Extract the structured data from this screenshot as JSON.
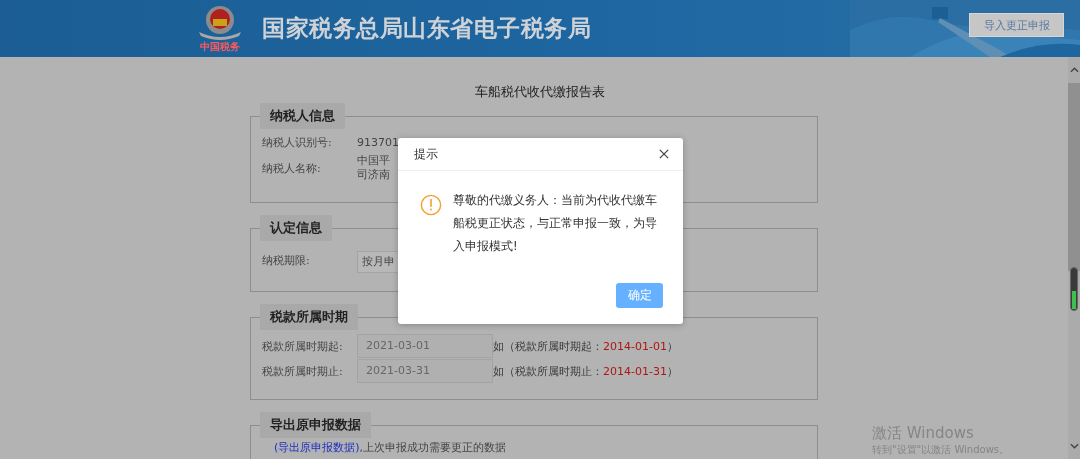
{
  "header": {
    "logo_caption": "中国税务",
    "title": "国家税务总局山东省电子税务局",
    "import_button": "导入更正申报"
  },
  "page_title": "车船税代收代缴报告表",
  "sections": [
    {
      "title": "纳税人信息",
      "kind": "info",
      "rows": [
        {
          "label": "纳税人识别号:",
          "values": [
            "913701"
          ]
        },
        {
          "label": "纳税人名称:",
          "values": [
            "中国平",
            "司济南"
          ]
        }
      ]
    },
    {
      "title": "认定信息",
      "kind": "select",
      "rows": [
        {
          "label": "纳税期限:",
          "value": "按月申"
        }
      ]
    },
    {
      "title": "税款所属时期",
      "kind": "dates",
      "rows": [
        {
          "label": "税款所属时期起:",
          "value": "2021-03-01",
          "note": {
            "prefix": "如（税款所属时期起：",
            "example": "2014-01-01",
            "suffix": "）"
          }
        },
        {
          "label": "税款所属时期止:",
          "value": "2021-03-31",
          "note": {
            "prefix": "如（税款所属时期止：",
            "example": "2014-01-31",
            "suffix": "）"
          }
        }
      ]
    },
    {
      "title": "导出原申报数据",
      "kind": "export",
      "link": "(导出原申报数据)",
      "text": ",上次申报成功需要更正的数据"
    }
  ],
  "dialog": {
    "title": "提示",
    "message": "尊敬的代缴义务人：当前为代收代缴车船税更正状态，与正常申报一致，为导入申报模式!",
    "confirm": "确定"
  },
  "os_notice": {
    "title": "激活 Windows",
    "text": "转到\"设置\"以激活 Windows。"
  }
}
